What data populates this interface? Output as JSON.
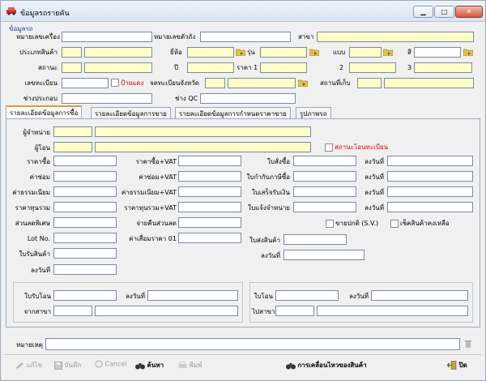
{
  "window": {
    "title": "ข้อมูลรถรายคัน",
    "min_icon": "minimize-icon",
    "max_icon": "maximize-icon",
    "close_icon": "close-icon",
    "min_glyph": "▁",
    "max_glyph": "□",
    "close_glyph": "✕"
  },
  "group": {
    "title": "ข้อมูลรถ"
  },
  "fields": {
    "chassis_no": "หมายเลขเครื่อง",
    "body_no": "หมายเลขตัวถัง",
    "branch": "สาขา",
    "product_type": "ประเภทสินค้า",
    "brand": "ยี่ห้อ",
    "model": "รุ่น",
    "style": "แบบ",
    "color": "สี",
    "status": "สถานะ",
    "year": "ปี",
    "price1": "ราคา 1",
    "price2": "2",
    "price3": "3",
    "reg_no": "เลขทะเบียน",
    "red_plate": "ป้ายแดง",
    "reg_province": "จดทะเบียนจังหวัด",
    "storage": "สถานที่เก็บ",
    "assembler": "ช่างประกอบ",
    "qc": "ช่าง QC"
  },
  "tabs": [
    {
      "label": "รายละเอียดข้อมูลการซื้อ",
      "active": true
    },
    {
      "label": "รายละเอียดข้อมูลการขาย",
      "active": false
    },
    {
      "label": "รายละเอียดข้อมูลการกำหนดราคาขาย",
      "active": false
    },
    {
      "label": "รูปภาพรถ",
      "active": false
    }
  ],
  "purchase": {
    "seller": "ผู้จำหน่าย",
    "transferee": "ผู้โอน",
    "reg_transfer_status": "สถานะโอนทะเบียน",
    "cost": "ราคาซื้อ",
    "cost_vat": "ราคาซื้อ+VAT",
    "po": "ใบสั่งซื้อ",
    "po_date": "ลงวันที่",
    "repair": "ค่าซ่อม",
    "repair_vat": "ค่าซ่อม+VAT",
    "tax_invoice": "ใบกำกับภาษีซื้อ",
    "tax_invoice_date": "ลงวันที่",
    "fee": "ค่าธรรมเนียม",
    "fee_vat": "ค่าธรรมเนียม+VAT",
    "payment_receipt": "ใบเสร็จรับเงิน",
    "payment_receipt_date": "ลงวันที่",
    "total_cost": "ราคาทุนรวม",
    "total_cost_vat": "ราคาทุนรวม+VAT",
    "sale_notice": "ใบแจ้งจำหน่าย",
    "sale_notice_date": "ลงวันที่",
    "special_discount": "ส่วนลดพิเศษ",
    "discount_return": "จ่ายคืนส่วนลด",
    "sv": "ขายปกติ (S.V.)",
    "check_remain": "เช็คสินค้าคงเหลือ",
    "lot": "Lot No.",
    "price_loss": "ค่าเสื่อมราคา 01",
    "delivery_note": "ใบส่งสินค้า",
    "receipt_note": "ใบรับสินค้า",
    "delivery_date": "ลงวันที่",
    "receipt_date": "ลงวันที่"
  },
  "transfer_in": {
    "receive_transfer": "ใบรับโอน",
    "date": "ลงวันที่",
    "from_branch": "จากสาขา"
  },
  "transfer_out": {
    "transfer": "ใบโอน",
    "date": "ลงวันที่",
    "to_branch": "ไปสาขา"
  },
  "remark": "หมายเหตุ",
  "toolbar": {
    "edit": "แก้ไข",
    "save": "บันทึก",
    "cancel": "Cancel",
    "search": "ค้นหา",
    "print": "พิมพ์",
    "movement": "การเคลื่อนไหวของสินค้า",
    "close": "ปิด"
  },
  "colors": {
    "input_yellow": "#ffffc8",
    "accent_red": "#e00000",
    "title_blue": "#1b3a9e"
  }
}
